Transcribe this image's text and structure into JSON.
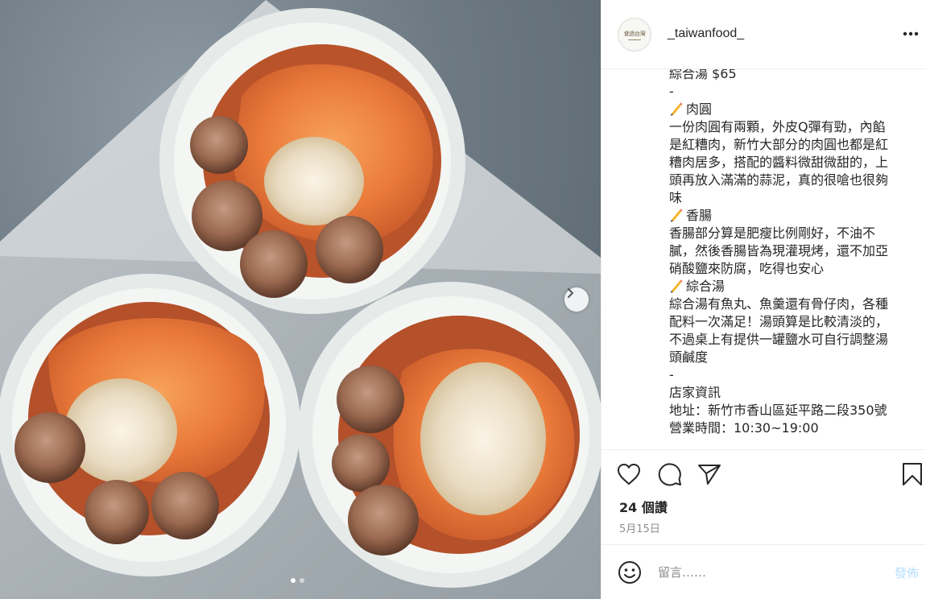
{
  "post": {
    "username": "_taiwanfood_",
    "avatar_text": "食過台灣",
    "more_icon": "ellipsis-icon",
    "caption_lines": [
      "綜合湯 $65",
      "-",
      "肉圓",
      "一份肉圓有兩顆，外皮Q彈有勁，內餡",
      "是紅糟肉，新竹大部分的肉圓也都是紅",
      "糟肉居多，搭配的醬料微甜微甜的，上",
      "頭再放入滿滿的蒜泥，真的很嗆也很夠",
      "味",
      "香腸",
      "香腸部分算是肥瘦比例剛好，不油不",
      "膩，然後香腸皆為現灌現烤，還不加亞",
      "硝酸鹽來防腐，吃得也安心",
      "綜合湯",
      "綜合湯有魚丸、魚羹還有骨仔肉，各種",
      "配料一次滿足！湯頭算是比較清淡的，",
      "不過桌上有提供一罐鹽水可自行調整湯",
      "頭鹹度",
      "-",
      "店家資訊",
      "地址：新竹市香山區延平路二段350號",
      "營業時間：10:30~19:00"
    ],
    "pencil_icon": "pencil-icon",
    "likes": "24 個讚",
    "date": "5月15日"
  },
  "actions": {
    "like_icon": "heart-icon",
    "comment_icon": "comment-icon",
    "share_icon": "send-icon",
    "save_icon": "bookmark-icon"
  },
  "comment": {
    "placeholder": "留言……",
    "post_label": "發佈",
    "emoji_icon": "emoji-icon"
  },
  "carousel": {
    "next_icon": "chevron-right-icon",
    "total": 2,
    "current": 1
  },
  "colors": {
    "link_disabled": "#b2dffc",
    "secondary_text": "#8e8e8e",
    "primary_text": "#262626"
  }
}
